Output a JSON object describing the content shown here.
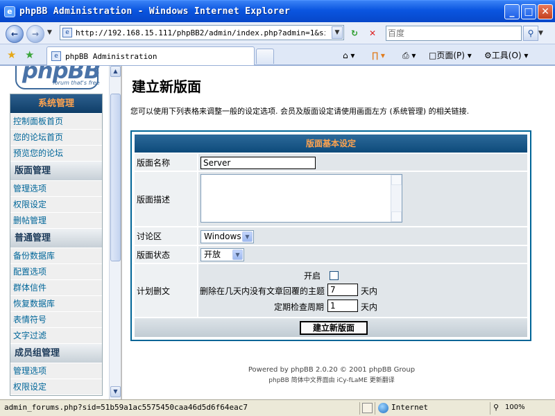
{
  "window": {
    "title": "phpBB Administration - Windows Internet Explorer",
    "buttons": [
      "_",
      "□",
      "✕"
    ]
  },
  "browser": {
    "url": "http://192.168.15.111/phpBB2/admin/index.php?admin=1&sid=51b5",
    "search_placeholder": "百度",
    "tab_title": "phpBB Administration",
    "page_menu": "页面(P)",
    "tools_menu": "工具(O)"
  },
  "sidebar": {
    "logo_text": "phpBB",
    "logo_tagline": "forum that's free",
    "sections": [
      {
        "title": "系统管理",
        "links": [
          "控制面板首页",
          "您的论坛首页",
          "预览您的论坛"
        ]
      },
      {
        "title": "版面管理",
        "links": [
          "管理选项",
          "权限设定",
          "删帖管理"
        ]
      },
      {
        "title": "普通管理",
        "links": [
          "备份数据库",
          "配置选项",
          "群体信件",
          "恢复数据库",
          "表情符号",
          "文字过滤"
        ]
      },
      {
        "title": "成员组管理",
        "links": [
          "管理选项",
          "权限设定"
        ]
      }
    ]
  },
  "main": {
    "title": "建立新版面",
    "intro": "您可以使用下列表格来调整一般的设定选项. 会员及版面设定请使用画面左方 (系统管理) 的相关链接.",
    "form": {
      "header": "版面基本设定",
      "name_label": "版面名称",
      "name_value": "Server",
      "desc_label": "版面描述",
      "desc_value": "",
      "category_label": "讨论区",
      "category_value": "Windows",
      "status_label": "版面状态",
      "status_value": "开放",
      "prune_label": "计划删文",
      "prune_enable_label": "开启",
      "prune_enabled": false,
      "prune_days_label": "删除在几天内没有文章回覆的主题",
      "prune_days_value": "7",
      "prune_freq_label": "定期检查周期",
      "prune_freq_value": "1",
      "days_unit": "天内",
      "submit_label": "建立新版面"
    },
    "footer_line1": "Powered by phpBB 2.0.20 © 2001 phpBB Group",
    "footer_line2": "phpBB 简体中文界面由 iCy-fLaME 更新翻译"
  },
  "statusbar": {
    "text": "admin_forums.php?sid=51b59a1ac5575450caa46d5d6f64eac7",
    "zone": "Internet",
    "zoom": "100%"
  },
  "colors": {
    "titlebar": "#0a55e0",
    "table_header": "#0d4a7a",
    "table_header_text": "#ffa34f",
    "link": "#006699",
    "form_border": "#006597"
  }
}
